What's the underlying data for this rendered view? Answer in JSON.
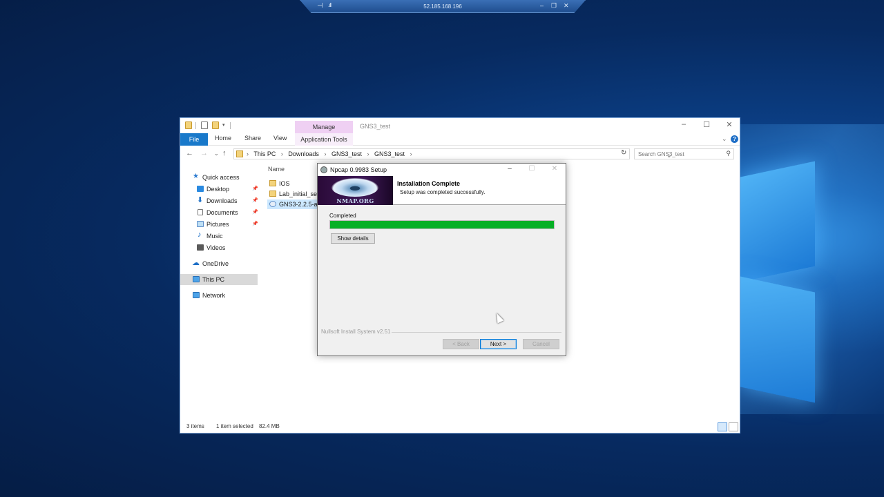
{
  "remote_bar": {
    "ip": "52.185.168.196",
    "minimize_icon": "minimize-icon",
    "restore_icon": "restore-icon",
    "close_icon": "close-icon"
  },
  "explorer": {
    "title": "GNS3_test",
    "manage_tab": "Manage",
    "ribbon": {
      "file": "File",
      "home": "Home",
      "share": "Share",
      "view": "View",
      "app_tools": "Application Tools"
    },
    "breadcrumb": [
      "This PC",
      "Downloads",
      "GNS3_test",
      "GNS3_test"
    ],
    "search_placeholder": "Search GNS3_test",
    "nav": {
      "quick_access": "Quick access",
      "desktop": "Desktop",
      "downloads": "Downloads",
      "documents": "Documents",
      "pictures": "Pictures",
      "music": "Music",
      "videos": "Videos",
      "onedrive": "OneDrive",
      "this_pc": "This PC",
      "network": "Network"
    },
    "column_name": "Name",
    "files": [
      "IOS",
      "Lab_initial_setup",
      "GNS3-2.2.5-all-in-one"
    ],
    "status": {
      "items": "3 items",
      "selected": "1 item selected",
      "size": "82.4 MB"
    }
  },
  "setup": {
    "title": "Npcap 0.9983 Setup",
    "banner_text": "NMAP.ORG",
    "header_title": "Installation Complete",
    "header_subtitle": "Setup was completed successfully.",
    "progress_label": "Completed",
    "progress": 1.0,
    "show_details": "Show details",
    "branding": "Nullsoft Install System v2.51",
    "back": "< Back",
    "next": "Next >",
    "cancel": "Cancel"
  },
  "colors": {
    "progress": "#06b025",
    "file_tab": "#1979ca",
    "manage_tab": "#efd0f3"
  }
}
